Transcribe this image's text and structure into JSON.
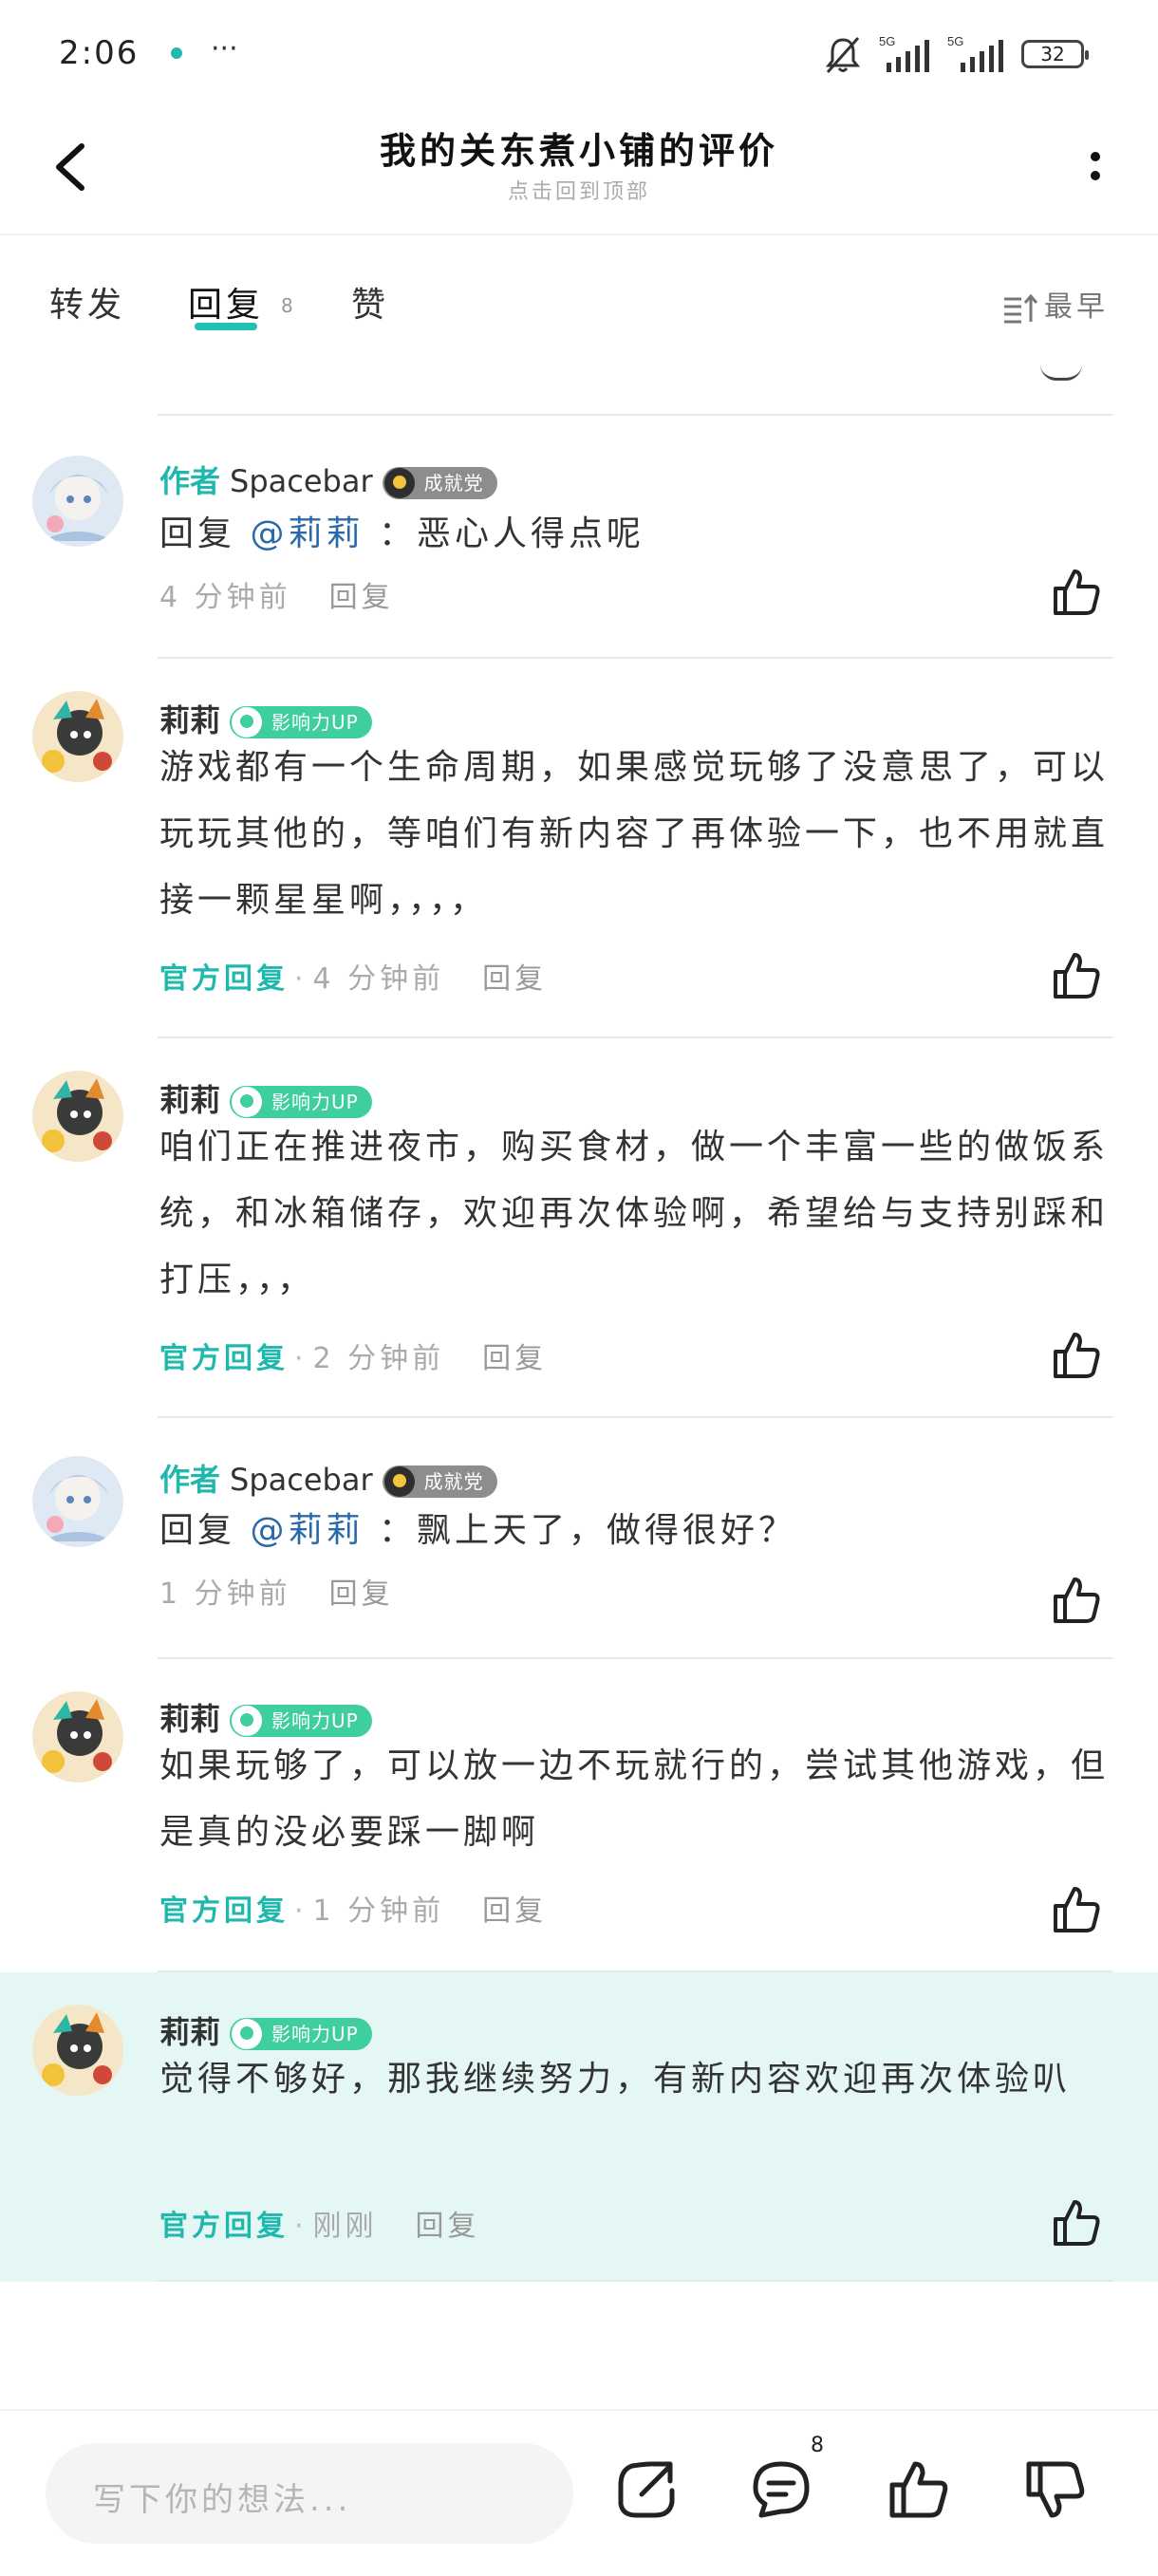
{
  "status_bar": {
    "time": "2:06",
    "more": "···",
    "battery": "32"
  },
  "header": {
    "title": "我的关东煮小铺的评价",
    "subtitle": "点击回到顶部"
  },
  "tabs": {
    "forward": "转发",
    "reply": "回复",
    "reply_count": "8",
    "like": "赞",
    "sort": "最早"
  },
  "comments": [
    {
      "author_tag": "作者",
      "name": "Spacebar",
      "badge": "成就党",
      "reply_prefix": "回复",
      "mention": "@莉莉",
      "text": "：恶心人得点呢",
      "official": "",
      "time": "4 分钟前",
      "reply_label": "回复"
    },
    {
      "name": "莉莉",
      "badge": "影响力UP",
      "text": "游戏都有一个生命周期，如果感觉玩够了没意思了，可以玩玩其他的，等咱们有新内容了再体验一下，也不用就直接一颗星星啊，，，，",
      "official": "官方回复",
      "time": "4 分钟前",
      "reply_label": "回复"
    },
    {
      "name": "莉莉",
      "badge": "影响力UP",
      "text": "咱们正在推进夜市，购买食材，做一个丰富一些的做饭系统，和冰箱储存，欢迎再次体验啊，希望给与支持别踩和打压，，，",
      "official": "官方回复",
      "time": "2 分钟前",
      "reply_label": "回复"
    },
    {
      "author_tag": "作者",
      "name": "Spacebar",
      "badge": "成就党",
      "reply_prefix": "回复",
      "mention": "@莉莉",
      "text": "：飘上天了，做得很好？",
      "official": "",
      "time": "1 分钟前",
      "reply_label": "回复"
    },
    {
      "name": "莉莉",
      "badge": "影响力UP",
      "text": "如果玩够了，可以放一边不玩就行的，尝试其他游戏，但是真的没必要踩一脚啊",
      "official": "官方回复",
      "time": "1 分钟前",
      "reply_label": "回复"
    },
    {
      "name": "莉莉",
      "badge": "影响力UP",
      "text": "觉得不够好，那我继续努力，有新内容欢迎再次体验叭",
      "official": "官方回复",
      "time": "刚刚",
      "reply_label": "回复"
    }
  ],
  "bottom_bar": {
    "placeholder": "写下你的想法...",
    "comment_count": "8"
  },
  "colors": {
    "accent": "#20c0b4",
    "mention": "#2b6aa8",
    "highlight_bg": "#e4f7f5",
    "badge_green": "#3fcf9d",
    "badge_grey": "#8d8d8d"
  }
}
